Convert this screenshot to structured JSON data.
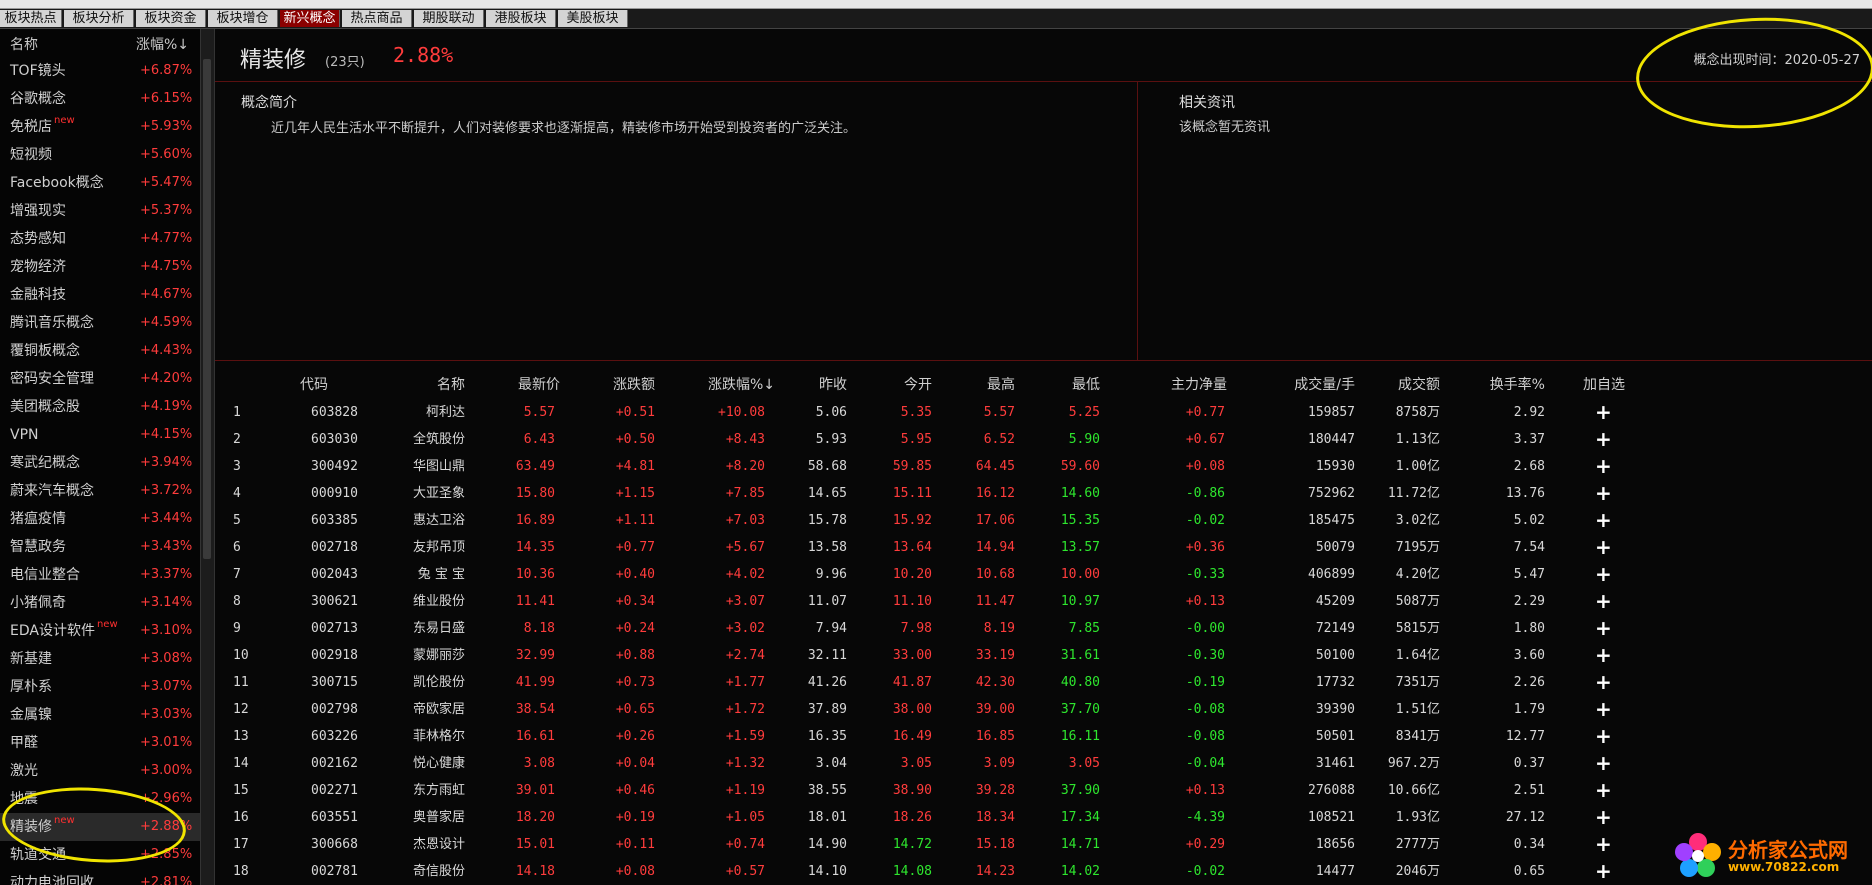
{
  "tabs": [
    "板块热点",
    "板块分析",
    "板块资金",
    "板块增仓",
    "新兴概念",
    "热点商品",
    "期股联动",
    "港股板块",
    "美股板块"
  ],
  "active_tab": "新兴概念",
  "sidebar": {
    "header_name": "名称",
    "header_pct": "涨幅%↓",
    "items": [
      {
        "name": "TOF镜头",
        "pct": "+6.87%"
      },
      {
        "name": "谷歌概念",
        "pct": "+6.15%"
      },
      {
        "name": "免税店",
        "pct": "+5.93%",
        "badge": "new"
      },
      {
        "name": "短视频",
        "pct": "+5.60%"
      },
      {
        "name": "Facebook概念",
        "pct": "+5.47%"
      },
      {
        "name": "增强现实",
        "pct": "+5.37%"
      },
      {
        "name": "态势感知",
        "pct": "+4.77%"
      },
      {
        "name": "宠物经济",
        "pct": "+4.75%"
      },
      {
        "name": "金融科技",
        "pct": "+4.67%"
      },
      {
        "name": "腾讯音乐概念",
        "pct": "+4.59%"
      },
      {
        "name": "覆铜板概念",
        "pct": "+4.43%"
      },
      {
        "name": "密码安全管理",
        "pct": "+4.20%"
      },
      {
        "name": "美团概念股",
        "pct": "+4.19%"
      },
      {
        "name": "VPN",
        "pct": "+4.15%"
      },
      {
        "name": "寒武纪概念",
        "pct": "+3.94%"
      },
      {
        "name": "蔚来汽车概念",
        "pct": "+3.72%"
      },
      {
        "name": "猪瘟疫情",
        "pct": "+3.44%"
      },
      {
        "name": "智慧政务",
        "pct": "+3.43%"
      },
      {
        "name": "电信业整合",
        "pct": "+3.37%"
      },
      {
        "name": "小猪佩奇",
        "pct": "+3.14%"
      },
      {
        "name": "EDA设计软件",
        "pct": "+3.10%",
        "badge": "new"
      },
      {
        "name": "新基建",
        "pct": "+3.08%"
      },
      {
        "name": "厚朴系",
        "pct": "+3.07%"
      },
      {
        "name": "金属镍",
        "pct": "+3.03%"
      },
      {
        "name": "甲醛",
        "pct": "+3.01%"
      },
      {
        "name": "激光",
        "pct": "+3.00%"
      },
      {
        "name": "地震",
        "pct": "+2.96%"
      },
      {
        "name": "精装修",
        "pct": "+2.88%",
        "badge": "new",
        "selected": true
      },
      {
        "name": "轨道交通",
        "pct": "+2.85%"
      },
      {
        "name": "动力电池回收",
        "pct": "+2.81%"
      }
    ]
  },
  "concept": {
    "name": "精装修",
    "count": "(23只)",
    "pct": "2.88%",
    "date_label": "概念出现时间：2020-05-27",
    "intro_title": "概念简介",
    "intro_text": "近几年人民生活水平不断提升，人们对装修要求也逐渐提高，精装修市场开始受到投资者的广泛关注。",
    "news_title": "相关资讯",
    "news_text": "该概念暂无资讯"
  },
  "table": {
    "headers": [
      "代码",
      "名称",
      "最新价",
      "涨跌额",
      "涨跌幅%↓",
      "昨收",
      "今开",
      "最高",
      "最低",
      "主力净量",
      "成交量/手",
      "成交额",
      "换手率%",
      "加自选"
    ],
    "rows": [
      [
        "1",
        "603828",
        "柯利达",
        "5.57",
        "+0.51",
        "+10.08",
        "5.06",
        "5.35",
        "5.57",
        "5.25",
        "+0.77",
        "159857",
        "8758万",
        "2.92"
      ],
      [
        "2",
        "603030",
        "全筑股份",
        "6.43",
        "+0.50",
        "+8.43",
        "5.93",
        "5.95",
        "6.52",
        "5.90",
        "+0.67",
        "180447",
        "1.13亿",
        "3.37"
      ],
      [
        "3",
        "300492",
        "华图山鼎",
        "63.49",
        "+4.81",
        "+8.20",
        "58.68",
        "59.85",
        "64.45",
        "59.60",
        "+0.08",
        "15930",
        "1.00亿",
        "2.68"
      ],
      [
        "4",
        "000910",
        "大亚圣象",
        "15.80",
        "+1.15",
        "+7.85",
        "14.65",
        "15.11",
        "16.12",
        "14.60",
        "-0.86",
        "752962",
        "11.72亿",
        "13.76"
      ],
      [
        "5",
        "603385",
        "惠达卫浴",
        "16.89",
        "+1.11",
        "+7.03",
        "15.78",
        "15.92",
        "17.06",
        "15.35",
        "-0.02",
        "185475",
        "3.02亿",
        "5.02"
      ],
      [
        "6",
        "002718",
        "友邦吊顶",
        "14.35",
        "+0.77",
        "+5.67",
        "13.58",
        "13.64",
        "14.94",
        "13.57",
        "+0.36",
        "50079",
        "7195万",
        "7.54"
      ],
      [
        "7",
        "002043",
        "兔 宝 宝",
        "10.36",
        "+0.40",
        "+4.02",
        "9.96",
        "10.20",
        "10.68",
        "10.00",
        "-0.33",
        "406899",
        "4.20亿",
        "5.47"
      ],
      [
        "8",
        "300621",
        "维业股份",
        "11.41",
        "+0.34",
        "+3.07",
        "11.07",
        "11.10",
        "11.47",
        "10.97",
        "+0.13",
        "45209",
        "5087万",
        "2.29"
      ],
      [
        "9",
        "002713",
        "东易日盛",
        "8.18",
        "+0.24",
        "+3.02",
        "7.94",
        "7.98",
        "8.19",
        "7.85",
        "-0.00",
        "72149",
        "5815万",
        "1.80"
      ],
      [
        "10",
        "002918",
        "蒙娜丽莎",
        "32.99",
        "+0.88",
        "+2.74",
        "32.11",
        "33.00",
        "33.19",
        "31.61",
        "-0.30",
        "50100",
        "1.64亿",
        "3.60"
      ],
      [
        "11",
        "300715",
        "凯伦股份",
        "41.99",
        "+0.73",
        "+1.77",
        "41.26",
        "41.87",
        "42.30",
        "40.80",
        "-0.19",
        "17732",
        "7351万",
        "2.26"
      ],
      [
        "12",
        "002798",
        "帝欧家居",
        "38.54",
        "+0.65",
        "+1.72",
        "37.89",
        "38.00",
        "39.00",
        "37.70",
        "-0.08",
        "39390",
        "1.51亿",
        "1.79"
      ],
      [
        "13",
        "603226",
        "菲林格尔",
        "16.61",
        "+0.26",
        "+1.59",
        "16.35",
        "16.49",
        "16.85",
        "16.11",
        "-0.08",
        "50501",
        "8341万",
        "12.77"
      ],
      [
        "14",
        "002162",
        "悦心健康",
        "3.08",
        "+0.04",
        "+1.32",
        "3.04",
        "3.05",
        "3.09",
        "3.05",
        "-0.04",
        "31461",
        "967.2万",
        "0.37"
      ],
      [
        "15",
        "002271",
        "东方雨虹",
        "39.01",
        "+0.46",
        "+1.19",
        "38.55",
        "38.90",
        "39.28",
        "37.90",
        "+0.13",
        "276088",
        "10.66亿",
        "2.51"
      ],
      [
        "16",
        "603551",
        "奥普家居",
        "18.20",
        "+0.19",
        "+1.05",
        "18.01",
        "18.26",
        "18.34",
        "17.34",
        "-4.39",
        "108521",
        "1.93亿",
        "27.12"
      ],
      [
        "17",
        "300668",
        "杰恩设计",
        "15.01",
        "+0.11",
        "+0.74",
        "14.90",
        "14.72",
        "15.18",
        "14.71",
        "+0.29",
        "18656",
        "2777万",
        "0.34"
      ],
      [
        "18",
        "002781",
        "奇信股份",
        "14.18",
        "+0.08",
        "+0.57",
        "14.10",
        "14.08",
        "14.23",
        "14.02",
        "-0.02",
        "14477",
        "2046万",
        "0.65"
      ]
    ],
    "add_symbol": "+"
  },
  "watermark": {
    "text": "分析家公式网",
    "url": "www.70822.com"
  },
  "colors": {
    "up": "#ff3c3c",
    "down": "#2ee62e",
    "accent": "#8b0000",
    "annotation": "#f0e400"
  }
}
